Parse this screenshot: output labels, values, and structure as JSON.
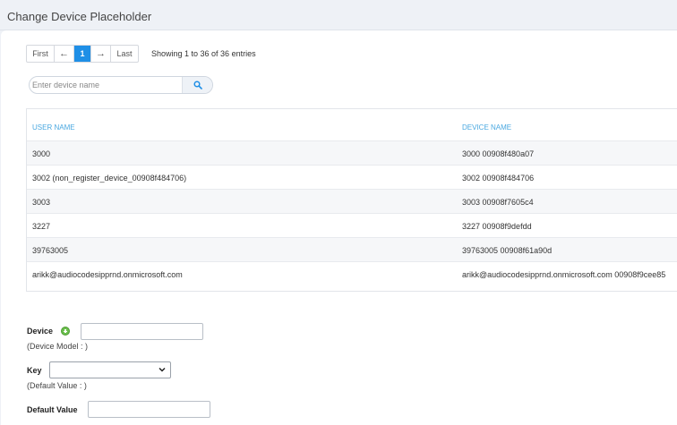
{
  "header": {
    "title": "Change Device Placeholder"
  },
  "pagination": {
    "first": "First",
    "prev": "←",
    "current": "1",
    "next": "→",
    "last": "Last",
    "info": "Showing 1 to 36 of 36 entries"
  },
  "search": {
    "placeholder": "Enter device name"
  },
  "table": {
    "columns": [
      "USER NAME",
      "DEVICE NAME"
    ],
    "rows": [
      {
        "user": "3000",
        "device": "3000 00908f480a07"
      },
      {
        "user": "3002 (non_register_device_00908f484706)",
        "device": "3002 00908f484706"
      },
      {
        "user": "3003",
        "device": "3003 00908f7605c4"
      },
      {
        "user": "3227",
        "device": "3227 00908f9defdd"
      },
      {
        "user": "39763005",
        "device": "39763005 00908f61a90d"
      },
      {
        "user": "arikk@audiocodesipprnd.onmicrosoft.com",
        "device": "arikk@audiocodesipprnd.onmicrosoft.com 00908f9cee85"
      }
    ]
  },
  "form": {
    "device_label": "Device",
    "device_model_note": "(Device Model : )",
    "key_label": "Key",
    "default_value_note": "(Default Value : )",
    "default_value_label": "Default Value"
  },
  "colors": {
    "accent": "#1f8fe6",
    "header_text": "#4aa8e0",
    "add": "#6cbf4e"
  }
}
